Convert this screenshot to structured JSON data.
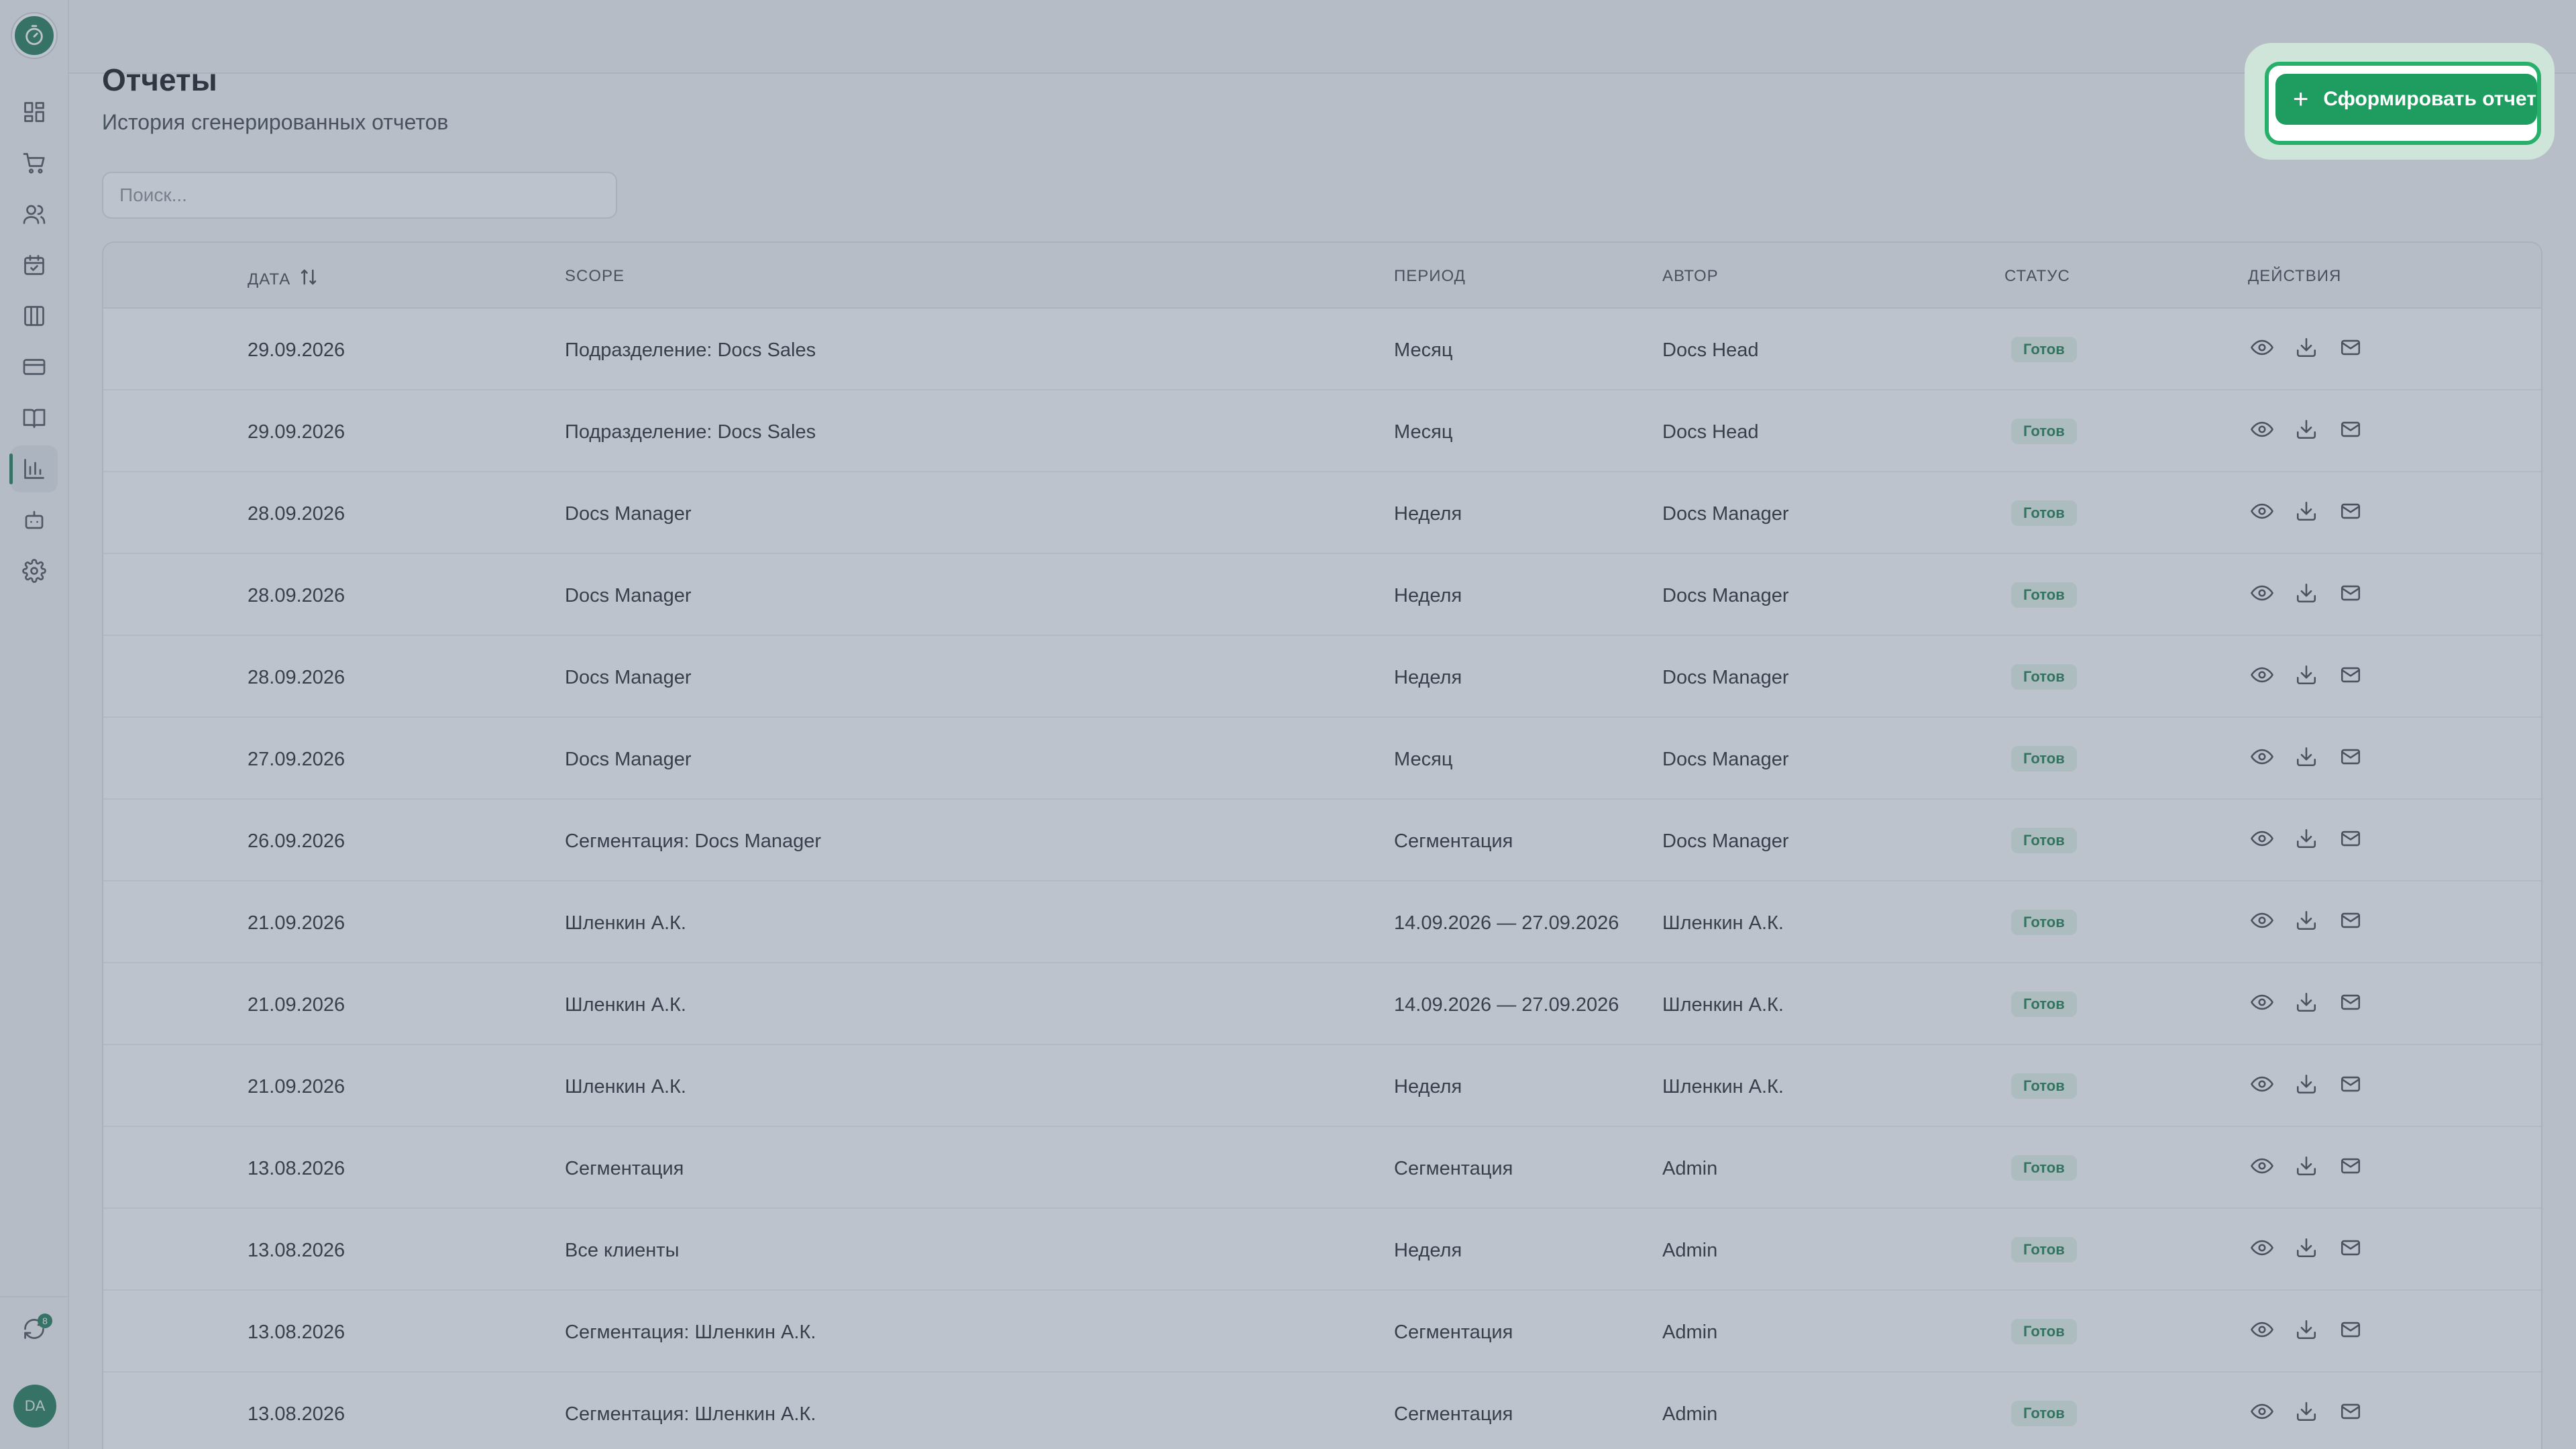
{
  "page": {
    "title": "Отчеты",
    "subtitle": "История сгенерированных отчетов",
    "create_button": "Сформировать отчет",
    "search_placeholder": "Поиск..."
  },
  "sidebar": {
    "items": [
      {
        "icon": "dashboard-icon"
      },
      {
        "icon": "cart-icon"
      },
      {
        "icon": "users-icon"
      },
      {
        "icon": "calendar-check-icon"
      },
      {
        "icon": "columns-icon"
      },
      {
        "icon": "credit-card-icon"
      },
      {
        "icon": "book-icon"
      },
      {
        "icon": "bar-chart-icon",
        "active": true
      },
      {
        "icon": "bot-icon"
      },
      {
        "icon": "gear-icon"
      }
    ],
    "sync_badge": "8",
    "avatar_initials": "DA"
  },
  "table": {
    "columns": [
      "ДАТА",
      "SCOPE",
      "ПЕРИОД",
      "АВТОР",
      "СТАТУС",
      "ДЕЙСТВИЯ"
    ],
    "rows": [
      {
        "date": "29.09.2026",
        "scope": "Подразделение: Docs Sales",
        "period": "Месяц",
        "author": "Docs Head",
        "status": "Готов"
      },
      {
        "date": "29.09.2026",
        "scope": "Подразделение: Docs Sales",
        "period": "Месяц",
        "author": "Docs Head",
        "status": "Готов"
      },
      {
        "date": "28.09.2026",
        "scope": "Docs Manager",
        "period": "Неделя",
        "author": "Docs Manager",
        "status": "Готов"
      },
      {
        "date": "28.09.2026",
        "scope": "Docs Manager",
        "period": "Неделя",
        "author": "Docs Manager",
        "status": "Готов"
      },
      {
        "date": "28.09.2026",
        "scope": "Docs Manager",
        "period": "Неделя",
        "author": "Docs Manager",
        "status": "Готов"
      },
      {
        "date": "27.09.2026",
        "scope": "Docs Manager",
        "period": "Месяц",
        "author": "Docs Manager",
        "status": "Готов"
      },
      {
        "date": "26.09.2026",
        "scope": "Сегментация: Docs Manager",
        "period": "Сегментация",
        "author": "Docs Manager",
        "status": "Готов"
      },
      {
        "date": "21.09.2026",
        "scope": "Шленкин А.К.",
        "period": "14.09.2026 — 27.09.2026",
        "author": "Шленкин А.К.",
        "status": "Готов"
      },
      {
        "date": "21.09.2026",
        "scope": "Шленкин А.К.",
        "period": "14.09.2026 — 27.09.2026",
        "author": "Шленкин А.К.",
        "status": "Готов"
      },
      {
        "date": "21.09.2026",
        "scope": "Шленкин А.К.",
        "period": "Неделя",
        "author": "Шленкин А.К.",
        "status": "Готов"
      },
      {
        "date": "13.08.2026",
        "scope": "Сегментация",
        "period": "Сегментация",
        "author": "Admin",
        "status": "Готов"
      },
      {
        "date": "13.08.2026",
        "scope": "Все клиенты",
        "period": "Неделя",
        "author": "Admin",
        "status": "Готов"
      },
      {
        "date": "13.08.2026",
        "scope": "Сегментация: Шленкин А.К.",
        "period": "Сегментация",
        "author": "Admin",
        "status": "Готов"
      },
      {
        "date": "13.08.2026",
        "scope": "Сегментация: Шленкин А.К.",
        "period": "Сегментация",
        "author": "Admin",
        "status": "Готов"
      }
    ],
    "row_actions": [
      "eye-icon",
      "download-icon",
      "mail-icon"
    ]
  },
  "colors": {
    "accent": "#1f9c5f",
    "badge_bg": "#e3f4ea",
    "badge_text": "#1c7a4a"
  }
}
